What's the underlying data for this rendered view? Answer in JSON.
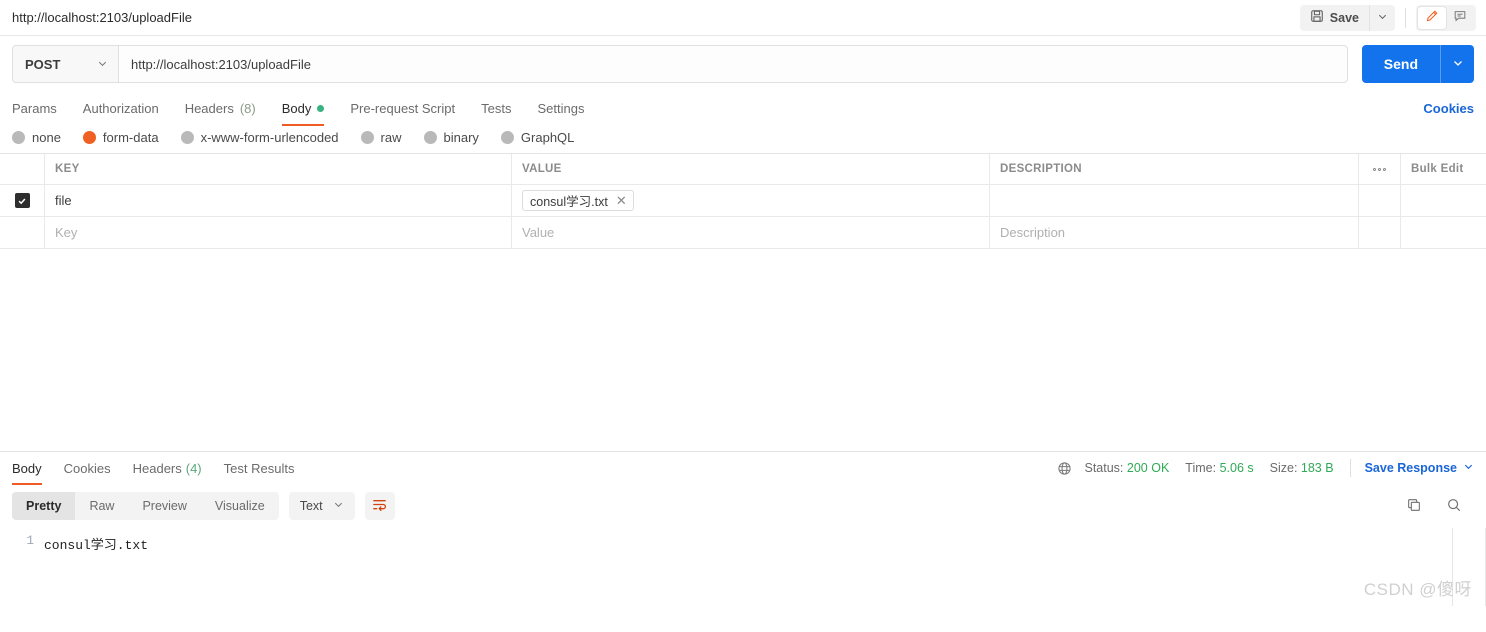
{
  "topbar": {
    "tab_title": "http://localhost:2103/uploadFile",
    "save_label": "Save",
    "save_icon": "floppy-disk-icon",
    "save_caret_icon": "chevron-down-icon",
    "edit_icon": "pencil-icon",
    "comment_icon": "comment-icon"
  },
  "urlbar": {
    "method": "POST",
    "method_caret_icon": "chevron-down-icon",
    "url_value": "http://localhost:2103/uploadFile",
    "url_placeholder": "Enter request URL",
    "send_label": "Send",
    "send_caret_icon": "chevron-down-icon",
    "send_color": "#1273ec"
  },
  "request_tabs": {
    "items": [
      {
        "label": "Params",
        "count": "",
        "active": false,
        "dot": false
      },
      {
        "label": "Authorization",
        "count": "",
        "active": false,
        "dot": false
      },
      {
        "label": "Headers",
        "count": "(8)",
        "active": false,
        "dot": false
      },
      {
        "label": "Body",
        "count": "",
        "active": true,
        "dot": true
      },
      {
        "label": "Pre-request Script",
        "count": "",
        "active": false,
        "dot": false
      },
      {
        "label": "Tests",
        "count": "",
        "active": false,
        "dot": false
      },
      {
        "label": "Settings",
        "count": "",
        "active": false,
        "dot": false
      }
    ],
    "cookies_label": "Cookies",
    "active_underline_color": "#ef5b25",
    "dot_color": "#36b37e"
  },
  "body_types": {
    "options": [
      {
        "label": "none",
        "selected": false
      },
      {
        "label": "form-data",
        "selected": true
      },
      {
        "label": "x-www-form-urlencoded",
        "selected": false
      },
      {
        "label": "raw",
        "selected": false
      },
      {
        "label": "binary",
        "selected": false
      },
      {
        "label": "GraphQL",
        "selected": false
      }
    ],
    "selected_color": "#f06023"
  },
  "kv_table": {
    "headers": {
      "key": "KEY",
      "value": "VALUE",
      "description": "DESCRIPTION",
      "more_icon": "ellipsis-icon",
      "bulk_edit": "Bulk Edit"
    },
    "rows": [
      {
        "checked": true,
        "key": "file",
        "value_chip": "consul学习.txt",
        "chip_remove_icon": "close-icon",
        "description": ""
      }
    ],
    "empty_row": {
      "key_placeholder": "Key",
      "value_placeholder": "Value",
      "description_placeholder": "Description"
    }
  },
  "response": {
    "tabs": [
      {
        "label": "Body",
        "count": "",
        "active": true
      },
      {
        "label": "Cookies",
        "count": "",
        "active": false
      },
      {
        "label": "Headers",
        "count": "(4)",
        "active": false
      },
      {
        "label": "Test Results",
        "count": "",
        "active": false
      }
    ],
    "globe_icon": "globe-icon",
    "status_label": "Status:",
    "status_value": "200 OK",
    "time_label": "Time:",
    "time_value": "5.06 s",
    "size_label": "Size:",
    "size_value": "183 B",
    "save_response_label": "Save Response",
    "save_response_caret_icon": "chevron-down-icon",
    "status_color": "#2faa55",
    "link_color": "#1a66d6"
  },
  "response_toolbar": {
    "views": [
      {
        "label": "Pretty",
        "active": true
      },
      {
        "label": "Raw",
        "active": false
      },
      {
        "label": "Preview",
        "active": false
      },
      {
        "label": "Visualize",
        "active": false
      }
    ],
    "format": "Text",
    "format_caret_icon": "chevron-down-icon",
    "wrap_icon": "word-wrap-icon",
    "copy_icon": "copy-icon",
    "search_icon": "search-icon"
  },
  "response_body": {
    "lines": [
      {
        "number": "1",
        "text": "consul学习.txt"
      }
    ]
  },
  "watermark": "CSDN @傻呀"
}
